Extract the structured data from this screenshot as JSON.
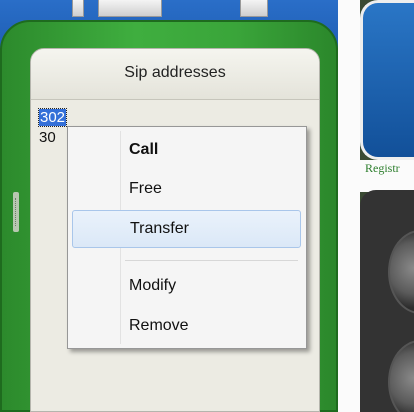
{
  "panel": {
    "title": "Sip addresses"
  },
  "list": [
    {
      "label": "302",
      "selected": true
    },
    {
      "label": "30"
    }
  ],
  "context_menu": {
    "items": [
      {
        "label": "Call",
        "bold": true
      },
      {
        "label": "Free"
      },
      {
        "label": "Transfer",
        "highlighted": true
      },
      {
        "label": "Modify"
      },
      {
        "label": "Remove"
      }
    ]
  },
  "right_panel": {
    "status_text": "Registr"
  },
  "colors": {
    "frame_green": "#3aa53a",
    "selection_blue": "#3470d8",
    "top_blue": "#1f5fb5"
  }
}
